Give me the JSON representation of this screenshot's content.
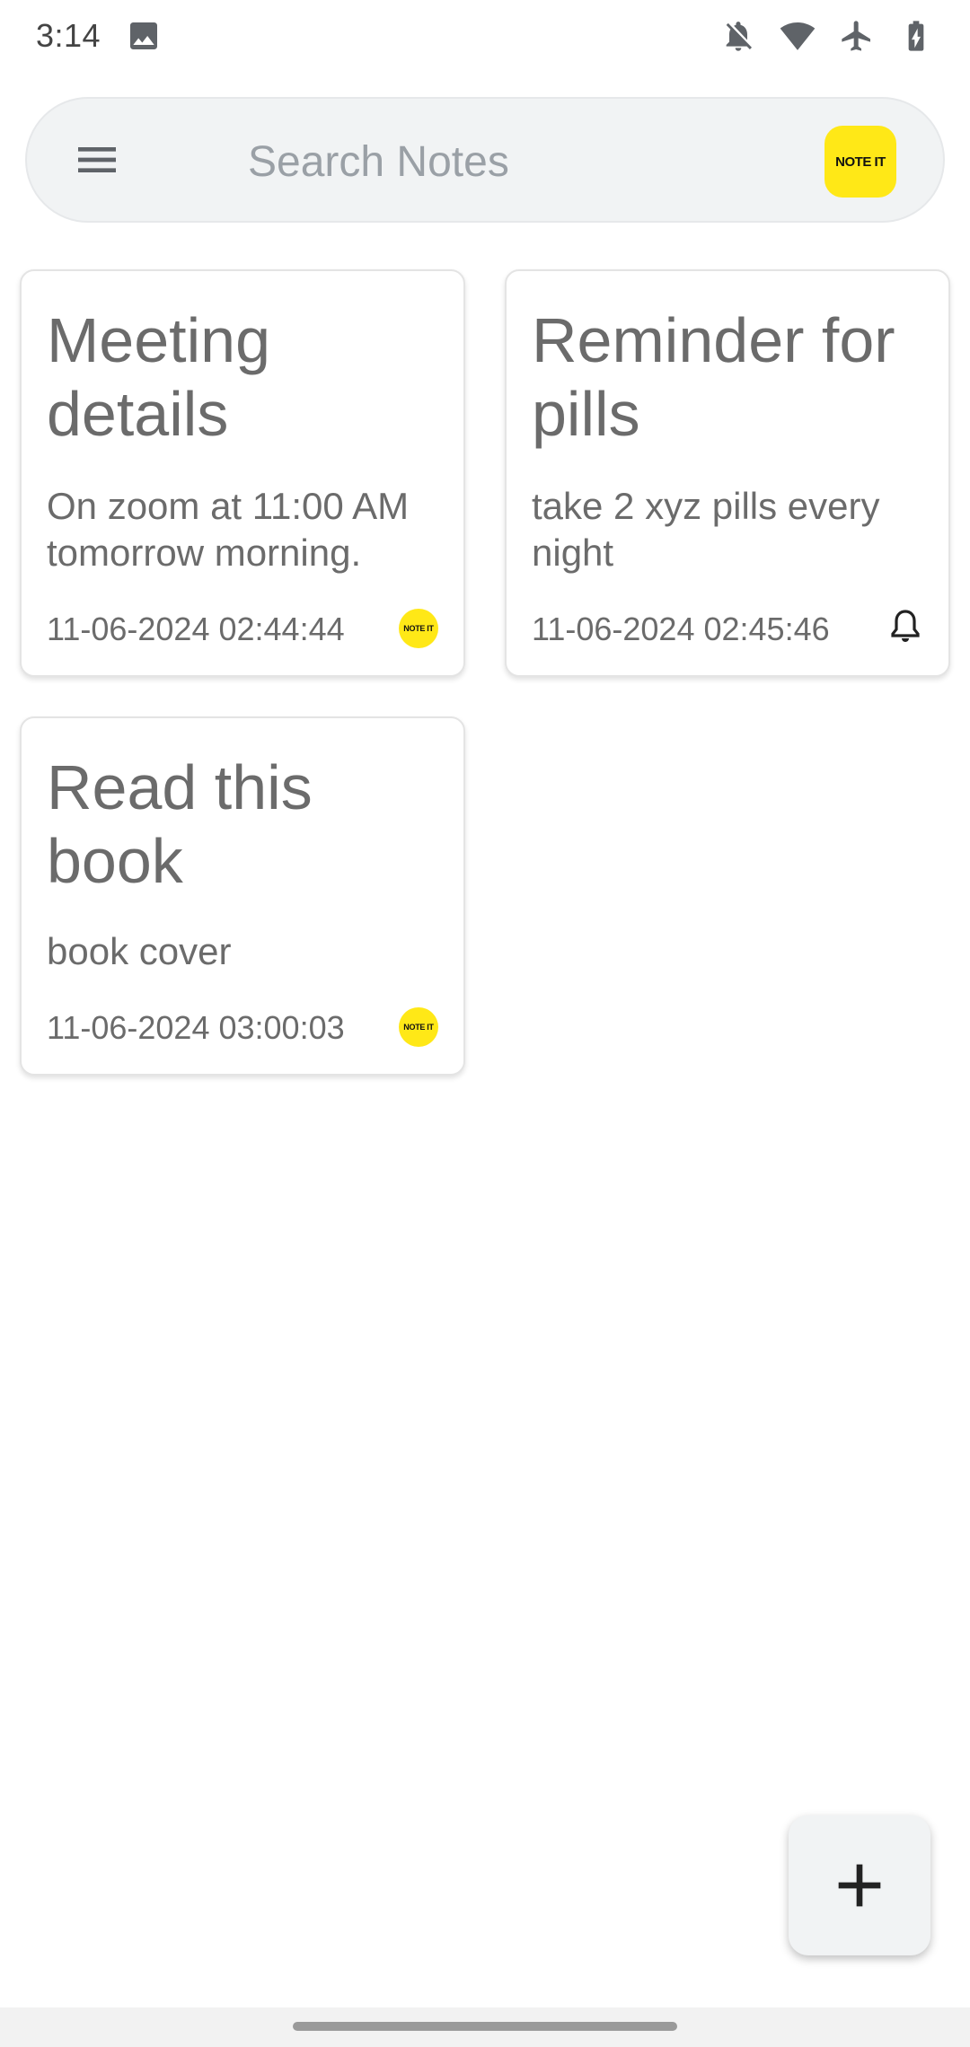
{
  "status_bar": {
    "time": "3:14",
    "icons": [
      "image-icon",
      "bell-off-icon",
      "wifi-icon",
      "airplane-icon",
      "battery-charging-icon"
    ]
  },
  "search": {
    "placeholder": "Search Notes",
    "menu_icon": "hamburger-menu-icon",
    "logo_text": "NOTE IT",
    "logo_color": "#ffe817"
  },
  "notes": [
    {
      "title": "Meeting details",
      "body": "On zoom at 11:00 AM tomorrow morning.",
      "date": "11-06-2024 02:44:44",
      "icon": "note-it-logo-icon"
    },
    {
      "title": "Reminder for pills",
      "body": "take 2 xyz pills every night",
      "date": "11-06-2024 02:45:46",
      "icon": "bell-icon"
    },
    {
      "title": "Read this book",
      "body": "book cover",
      "date": "11-06-2024 03:00:03",
      "icon": "note-it-logo-icon"
    }
  ],
  "fab": {
    "icon": "plus-icon"
  },
  "colors": {
    "text": "#6b6b6b",
    "search_bg": "#f1f3f4",
    "accent": "#ffe817"
  }
}
